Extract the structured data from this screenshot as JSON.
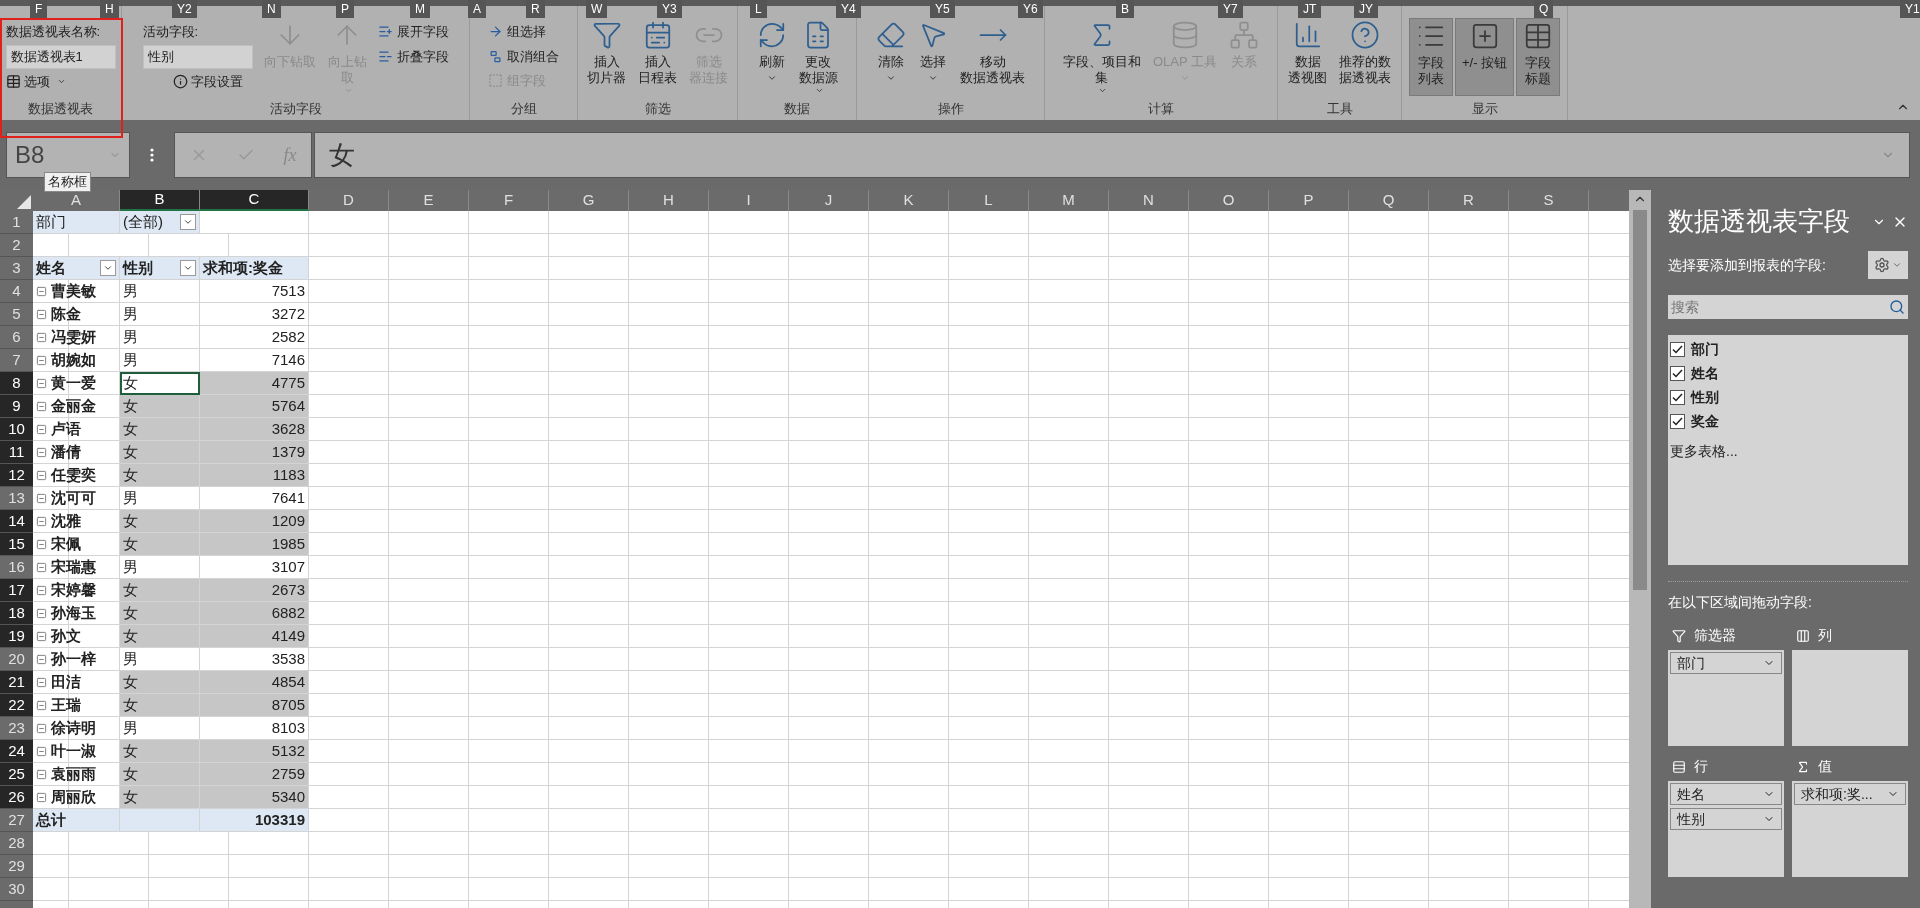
{
  "keytips": [
    "F",
    "H",
    "Y2",
    "N",
    "P",
    "M",
    "A",
    "R",
    "W",
    "Y3",
    "L",
    "Y4",
    "Y5",
    "Y6",
    "B",
    "Y7",
    "JT",
    "JY",
    "Q",
    "Y1"
  ],
  "ribbon": {
    "groups": [
      {
        "label": "数据透视表",
        "items": [
          {
            "kind": "name",
            "label": "数据透视表名称:",
            "value": "数据透视表1",
            "button": {
              "label": "选项",
              "dropdown": true
            }
          }
        ]
      },
      {
        "label": "活动字段",
        "items": [
          {
            "kind": "name",
            "label": "活动字段:",
            "value": "性别",
            "button": {
              "label": "字段设置",
              "dropdown": false
            }
          },
          {
            "kind": "large",
            "lines": [
              "向下钻取"
            ],
            "disabled": true,
            "dropdown": false
          },
          {
            "kind": "large",
            "lines": [
              "向上钻",
              "取"
            ],
            "disabled": true,
            "dropdown": true
          },
          {
            "kind": "stack",
            "buttons": [
              {
                "label": "展开字段",
                "disabled": false
              },
              {
                "label": "折叠字段",
                "disabled": false
              }
            ]
          }
        ]
      },
      {
        "label": "分组",
        "items": [
          {
            "kind": "stack",
            "buttons": [
              {
                "label": "组选择",
                "disabled": false
              },
              {
                "label": "取消组合",
                "disabled": false
              },
              {
                "label": "组字段",
                "disabled": true
              }
            ]
          }
        ]
      },
      {
        "label": "筛选",
        "items": [
          {
            "kind": "large",
            "lines": [
              "插入",
              "切片器"
            ],
            "disabled": false,
            "dropdown": false
          },
          {
            "kind": "large",
            "lines": [
              "插入",
              "日程表"
            ],
            "disabled": false,
            "dropdown": false
          },
          {
            "kind": "large",
            "lines": [
              "筛选",
              "器连接"
            ],
            "disabled": true,
            "dropdown": false
          }
        ]
      },
      {
        "label": "数据",
        "items": [
          {
            "kind": "large",
            "lines": [
              "刷新"
            ],
            "disabled": false,
            "dropdown": true
          },
          {
            "kind": "large",
            "lines": [
              "更改",
              "数据源"
            ],
            "disabled": false,
            "dropdown": true
          }
        ]
      },
      {
        "label": "操作",
        "items": [
          {
            "kind": "large",
            "lines": [
              "清除"
            ],
            "disabled": false,
            "dropdown": true
          },
          {
            "kind": "large",
            "lines": [
              "选择"
            ],
            "disabled": false,
            "dropdown": true
          },
          {
            "kind": "large",
            "lines": [
              "移动",
              "数据透视表"
            ],
            "disabled": false,
            "dropdown": false
          }
        ]
      },
      {
        "label": "计算",
        "items": [
          {
            "kind": "large",
            "lines": [
              "字段、项目和",
              "集"
            ],
            "disabled": false,
            "dropdown": true
          },
          {
            "kind": "large",
            "lines": [
              "OLAP 工具"
            ],
            "disabled": true,
            "dropdown": true
          },
          {
            "kind": "large",
            "lines": [
              "关系"
            ],
            "disabled": true,
            "dropdown": false
          }
        ]
      },
      {
        "label": "工具",
        "items": [
          {
            "kind": "large",
            "lines": [
              "数据",
              "透视图"
            ],
            "disabled": false,
            "dropdown": false
          },
          {
            "kind": "large",
            "lines": [
              "推荐的数",
              "据透视表"
            ],
            "disabled": false,
            "dropdown": false
          }
        ]
      },
      {
        "label": "显示",
        "items": [
          {
            "kind": "toggle",
            "lines": [
              "字段",
              "列表"
            ],
            "selected": true
          },
          {
            "kind": "toggle",
            "lines": [
              "+/- 按钮"
            ],
            "selected": true
          },
          {
            "kind": "toggle",
            "lines": [
              "字段",
              "标题"
            ],
            "selected": true
          }
        ]
      }
    ]
  },
  "formula_bar": {
    "name_box": "B8",
    "fx": "fx",
    "value": "女"
  },
  "tooltip": "名称框",
  "columns": [
    {
      "label": "A",
      "selected": false
    },
    {
      "label": "B",
      "selected": true
    },
    {
      "label": "C",
      "selected": true
    },
    {
      "label": "D",
      "selected": false
    },
    {
      "label": "E",
      "selected": false
    },
    {
      "label": "F",
      "selected": false
    },
    {
      "label": "G",
      "selected": false
    },
    {
      "label": "H",
      "selected": false
    },
    {
      "label": "I",
      "selected": false
    },
    {
      "label": "J",
      "selected": false
    },
    {
      "label": "K",
      "selected": false
    },
    {
      "label": "L",
      "selected": false
    },
    {
      "label": "M",
      "selected": false
    },
    {
      "label": "N",
      "selected": false
    },
    {
      "label": "O",
      "selected": false
    },
    {
      "label": "P",
      "selected": false
    },
    {
      "label": "Q",
      "selected": false
    },
    {
      "label": "R",
      "selected": false
    },
    {
      "label": "S",
      "selected": false
    }
  ],
  "row_headers": [
    {
      "label": "1",
      "selected": false
    },
    {
      "label": "2",
      "selected": false
    },
    {
      "label": "3",
      "selected": false
    },
    {
      "label": "4",
      "selected": false
    },
    {
      "label": "5",
      "selected": false
    },
    {
      "label": "6",
      "selected": false
    },
    {
      "label": "7",
      "selected": false
    },
    {
      "label": "8",
      "selected": true
    },
    {
      "label": "9",
      "selected": true
    },
    {
      "label": "10",
      "selected": true
    },
    {
      "label": "11",
      "selected": true
    },
    {
      "label": "12",
      "selected": true
    },
    {
      "label": "13",
      "selected": false
    },
    {
      "label": "14",
      "selected": true
    },
    {
      "label": "15",
      "selected": true
    },
    {
      "label": "16",
      "selected": false
    },
    {
      "label": "17",
      "selected": true
    },
    {
      "label": "18",
      "selected": true
    },
    {
      "label": "19",
      "selected": true
    },
    {
      "label": "20",
      "selected": false
    },
    {
      "label": "21",
      "selected": true
    },
    {
      "label": "22",
      "selected": true
    },
    {
      "label": "23",
      "selected": false
    },
    {
      "label": "24",
      "selected": true
    },
    {
      "label": "25",
      "selected": true
    },
    {
      "label": "26",
      "selected": true
    },
    {
      "label": "27",
      "selected": false
    },
    {
      "label": "28",
      "selected": false
    },
    {
      "label": "29",
      "selected": false
    },
    {
      "label": "30",
      "selected": false
    }
  ],
  "pivot": {
    "filter": {
      "label": "部门",
      "value": "(全部)"
    },
    "headers": [
      "姓名",
      "性别",
      "求和项:奖金"
    ],
    "rows": [
      {
        "name": "曹美敏",
        "gender": "男",
        "amount": "7513",
        "selected": false,
        "active": false
      },
      {
        "name": "陈金",
        "gender": "男",
        "amount": "3272",
        "selected": false,
        "active": false
      },
      {
        "name": "冯雯妍",
        "gender": "男",
        "amount": "2582",
        "selected": false,
        "active": false
      },
      {
        "name": "胡婉如",
        "gender": "男",
        "amount": "7146",
        "selected": false,
        "active": false
      },
      {
        "name": "黄一爱",
        "gender": "女",
        "amount": "4775",
        "selected": true,
        "active": true
      },
      {
        "name": "金丽金",
        "gender": "女",
        "amount": "5764",
        "selected": true,
        "active": false
      },
      {
        "name": "卢语",
        "gender": "女",
        "amount": "3628",
        "selected": true,
        "active": false
      },
      {
        "name": "潘倩",
        "gender": "女",
        "amount": "1379",
        "selected": true,
        "active": false
      },
      {
        "name": "任雯奕",
        "gender": "女",
        "amount": "1183",
        "selected": true,
        "active": false
      },
      {
        "name": "沈可可",
        "gender": "男",
        "amount": "7641",
        "selected": false,
        "active": false
      },
      {
        "name": "沈雅",
        "gender": "女",
        "amount": "1209",
        "selected": true,
        "active": false
      },
      {
        "name": "宋佩",
        "gender": "女",
        "amount": "1985",
        "selected": true,
        "active": false
      },
      {
        "name": "宋瑞惠",
        "gender": "男",
        "amount": "3107",
        "selected": false,
        "active": false
      },
      {
        "name": "宋婷馨",
        "gender": "女",
        "amount": "2673",
        "selected": true,
        "active": false
      },
      {
        "name": "孙海玉",
        "gender": "女",
        "amount": "6882",
        "selected": true,
        "active": false
      },
      {
        "name": "孙文",
        "gender": "女",
        "amount": "4149",
        "selected": true,
        "active": false
      },
      {
        "name": "孙一梓",
        "gender": "男",
        "amount": "3538",
        "selected": false,
        "active": false
      },
      {
        "name": "田洁",
        "gender": "女",
        "amount": "4854",
        "selected": true,
        "active": false
      },
      {
        "name": "王瑞",
        "gender": "女",
        "amount": "8705",
        "selected": true,
        "active": false
      },
      {
        "name": "徐诗明",
        "gender": "男",
        "amount": "8103",
        "selected": false,
        "active": false
      },
      {
        "name": "叶一淑",
        "gender": "女",
        "amount": "5132",
        "selected": true,
        "active": false
      },
      {
        "name": "袁丽雨",
        "gender": "女",
        "amount": "2759",
        "selected": true,
        "active": false
      },
      {
        "name": "周丽欣",
        "gender": "女",
        "amount": "5340",
        "selected": true,
        "active": false
      }
    ],
    "total": {
      "label": "总计",
      "value": "103319"
    }
  },
  "field_pane": {
    "title": "数据透视表字段",
    "subtitle": "选择要添加到报表的字段:",
    "search": {
      "placeholder": "搜索"
    },
    "fields": [
      {
        "label": "部门",
        "checked": true
      },
      {
        "label": "姓名",
        "checked": true
      },
      {
        "label": "性别",
        "checked": true
      },
      {
        "label": "奖金",
        "checked": true
      }
    ],
    "more_tables": "更多表格...",
    "areas_hint": "在以下区域间拖动字段:",
    "areas": [
      {
        "title": "筛选器",
        "items": [
          "部门"
        ]
      },
      {
        "title": "列"
      },
      {
        "title": "行",
        "items": [
          "姓名",
          "性别"
        ]
      },
      {
        "title": "值",
        "items": [
          "求和项:奖..."
        ]
      }
    ]
  }
}
